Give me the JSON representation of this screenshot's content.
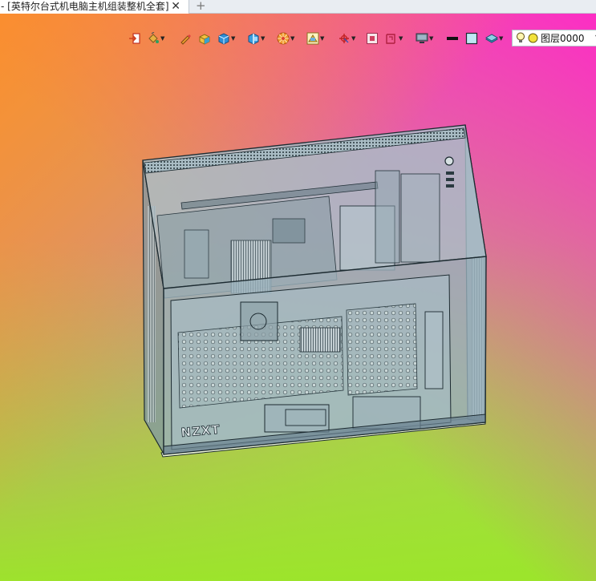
{
  "document_tab": {
    "title": "- [英特尔台式机电脑主机组装整机全套]",
    "close_glyph": "✕",
    "new_tab_glyph": "+"
  },
  "toolbar": {
    "tools": [
      {
        "name": "exit-sketch-icon"
      },
      {
        "name": "paint-bucket-icon"
      },
      {
        "name": "pencil-icon"
      },
      {
        "name": "solid-box-icon"
      },
      {
        "name": "cube-view-icon"
      },
      {
        "name": "section-view-icon"
      },
      {
        "name": "appearance-wheel-icon"
      },
      {
        "name": "display-style-icon"
      },
      {
        "name": "axis-triad-icon"
      },
      {
        "name": "zoom-window-icon"
      },
      {
        "name": "rotate-view-icon"
      },
      {
        "name": "monitor-icon"
      },
      {
        "name": "line-weight-icon"
      },
      {
        "name": "color-swatch-icon"
      },
      {
        "name": "layer-stack-icon"
      }
    ],
    "layer": {
      "name": "图层0000",
      "arrow": "▾"
    }
  },
  "model": {
    "name": "desktop-pc-assembly",
    "logo_text": "NZXT"
  },
  "colors": {
    "tab_background": "#e9edf2",
    "case_glass": "#8fb4c4",
    "case_edge": "#1c2a30",
    "base_plate": "#e8f0d0"
  }
}
